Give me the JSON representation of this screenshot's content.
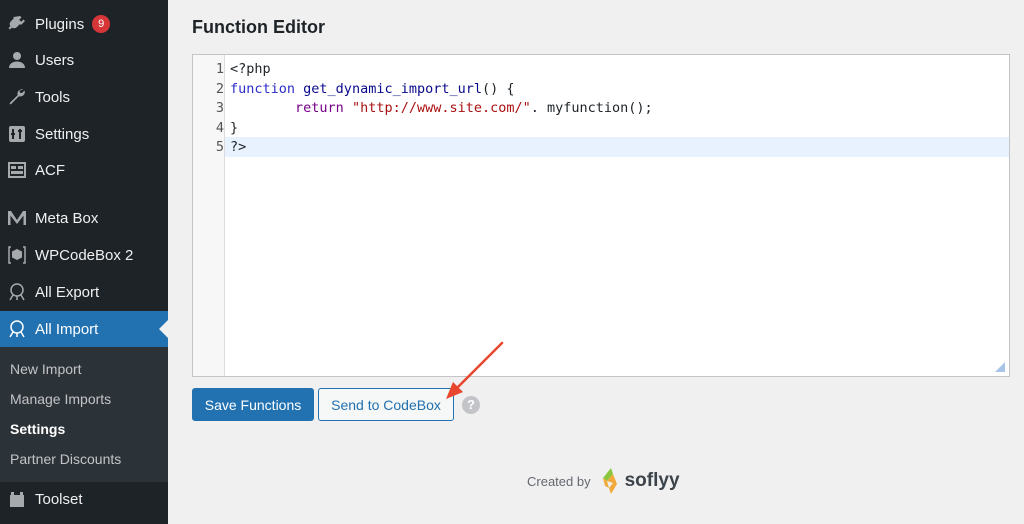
{
  "sidebar": {
    "items": [
      {
        "label": "Plugins",
        "icon": "plugin-icon",
        "badge": "9"
      },
      {
        "label": "Users",
        "icon": "users-icon"
      },
      {
        "label": "Tools",
        "icon": "wrench-icon"
      },
      {
        "label": "Settings",
        "icon": "settings-icon"
      },
      {
        "label": "ACF",
        "icon": "acf-icon"
      },
      {
        "label": "Meta Box",
        "icon": "metabox-logo-icon"
      },
      {
        "label": "WPCodeBox 2",
        "icon": "codebox-icon"
      },
      {
        "label": "All Export",
        "icon": "all-export-icon"
      },
      {
        "label": "All Import",
        "icon": "all-import-icon",
        "active": true
      }
    ],
    "submenu": [
      {
        "label": "New Import"
      },
      {
        "label": "Manage Imports"
      },
      {
        "label": "Settings",
        "current": true
      },
      {
        "label": "Partner Discounts"
      }
    ],
    "bottom_item": {
      "label": "Toolset",
      "icon": "toolset-icon"
    }
  },
  "page": {
    "title": "Function Editor"
  },
  "editor": {
    "line_numbers": [
      "1",
      "2",
      "3",
      "4",
      "5"
    ],
    "lines": {
      "l1": "<?php",
      "l2_kw": "function",
      "l2_fn": "get_dynamic_import_url",
      "l2_rest": "() {",
      "l3_indent": "        ",
      "l3_kw": "return",
      "l3_str": "\"http://www.site.com/\"",
      "l3_rest": ". myfunction();",
      "l4": "}",
      "l5": "?>"
    }
  },
  "buttons": {
    "save": "Save Functions",
    "send": "Send to CodeBox",
    "help": "?"
  },
  "footer": {
    "created_by": "Created by",
    "brand": "soflyy"
  },
  "colors": {
    "sidebar_bg": "#1d2327",
    "accent": "#2271b1",
    "badge": "#d63638",
    "annotation_arrow": "#e8462f"
  }
}
